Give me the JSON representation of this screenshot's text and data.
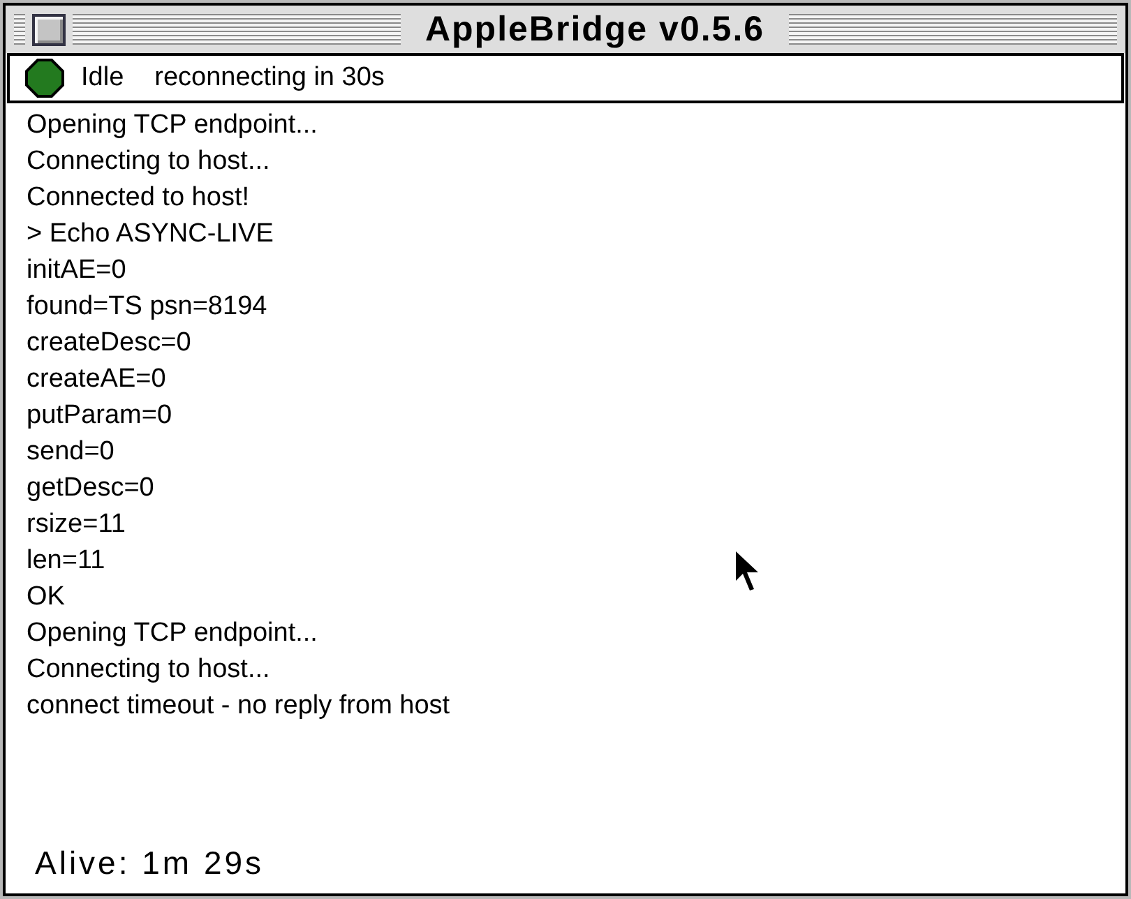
{
  "window": {
    "title": "AppleBridge v0.5.6"
  },
  "status": {
    "color": "#237a1f",
    "state": "Idle",
    "message": "reconnecting in 30s"
  },
  "log": {
    "lines": [
      "Opening TCP endpoint...",
      "Connecting to host...",
      "Connected to host!",
      "> Echo ASYNC-LIVE",
      "initAE=0",
      "found=TS psn=8194",
      "createDesc=0",
      "createAE=0",
      "putParam=0",
      "send=0",
      "getDesc=0",
      "rsize=11",
      "len=11",
      "OK",
      "Opening TCP endpoint...",
      "Connecting to host...",
      "connect timeout - no reply from host"
    ]
  },
  "footer": {
    "uptime": "Alive: 1m 29s"
  }
}
